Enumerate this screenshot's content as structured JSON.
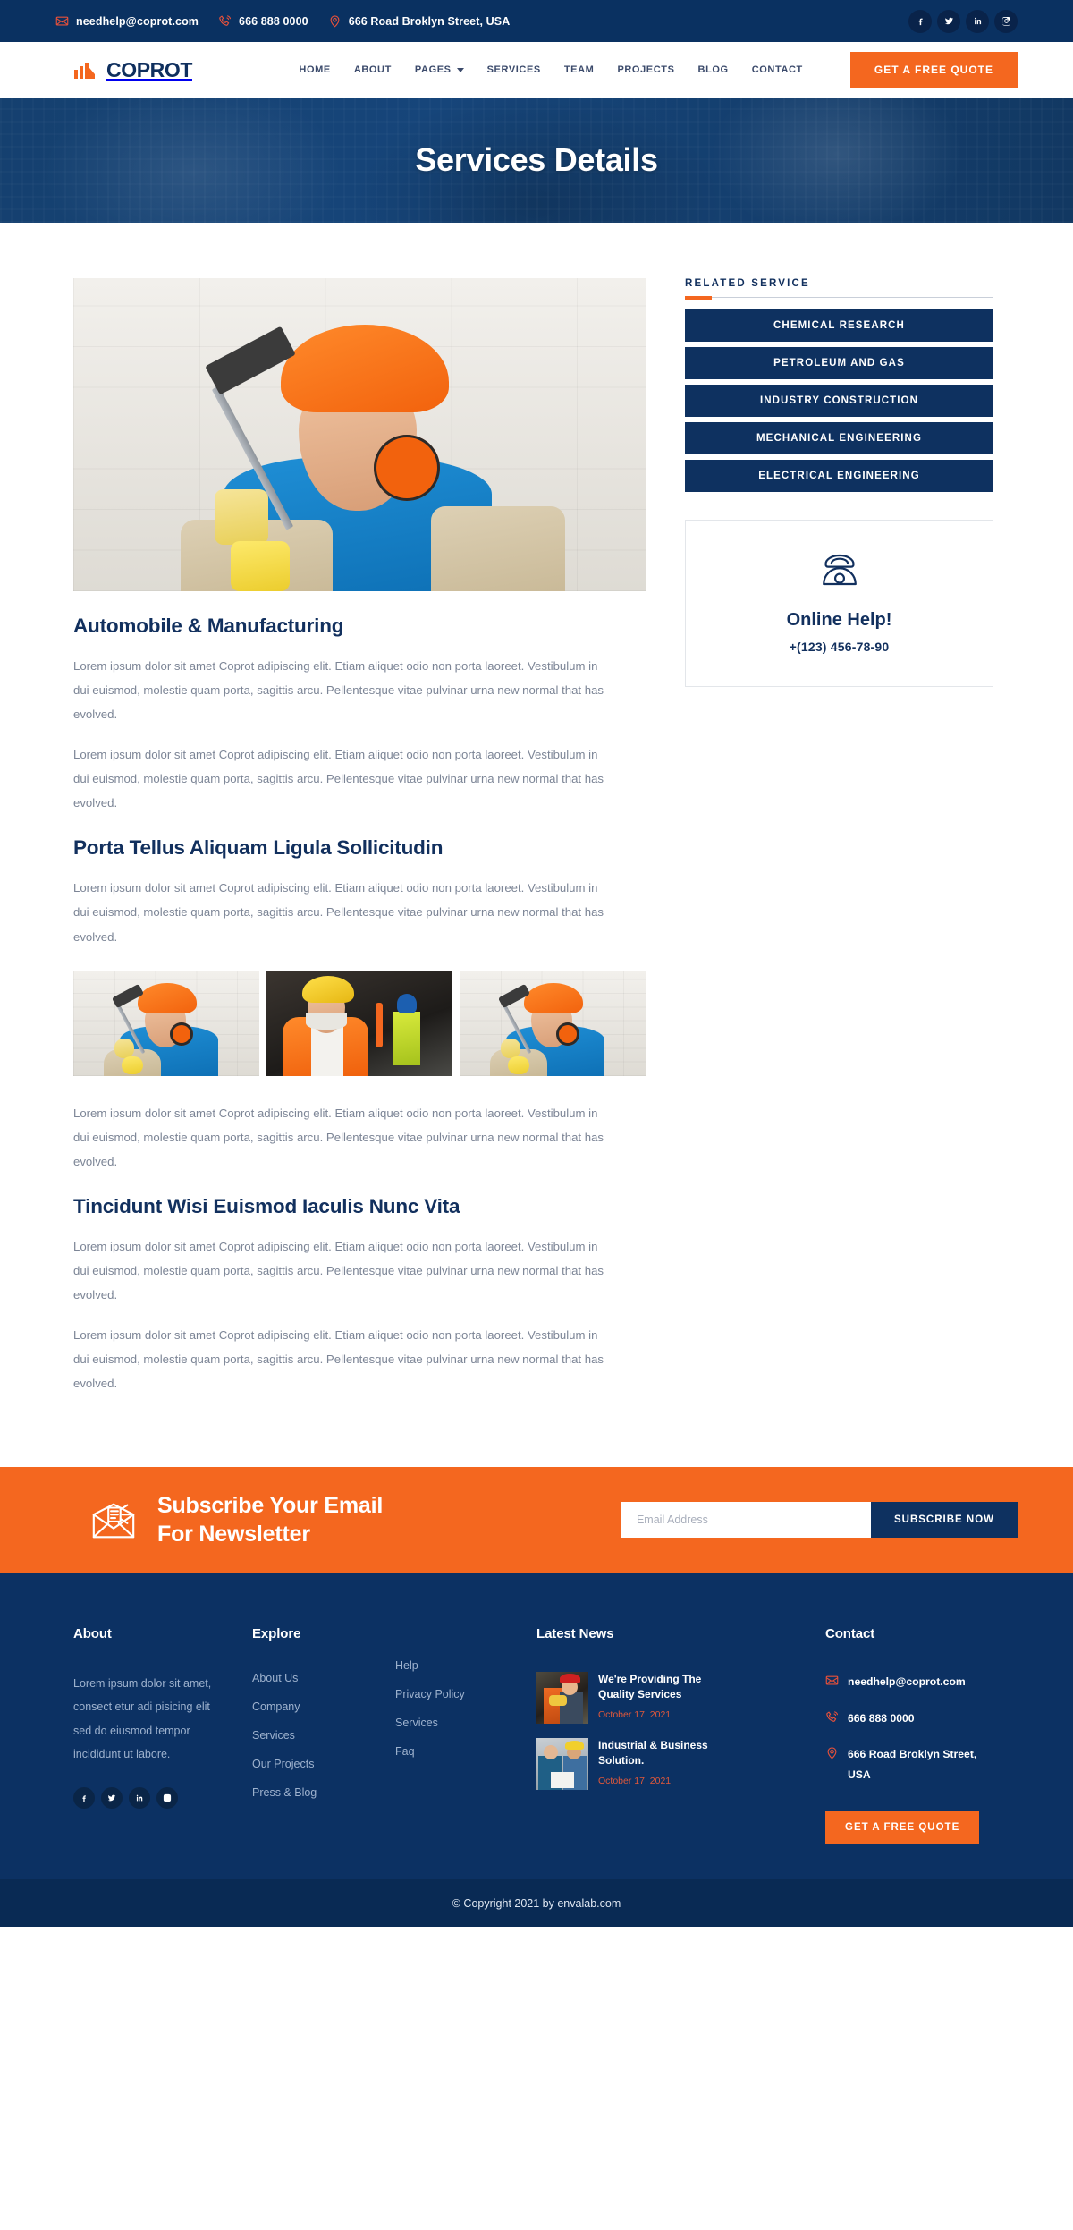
{
  "topbar": {
    "contacts": [
      {
        "icon": "email-icon",
        "text": "needhelp@coprot.com"
      },
      {
        "icon": "phone-icon",
        "text": "666 888 0000"
      },
      {
        "icon": "location-pin-icon",
        "text": "666 Road Broklyn Street, USA"
      }
    ],
    "socials": [
      "facebook-icon",
      "twitter-icon",
      "linkedin-icon",
      "instagram-icon"
    ]
  },
  "header": {
    "brand": "COPROT",
    "nav": [
      {
        "label": "HOME",
        "dropdown": false
      },
      {
        "label": "ABOUT",
        "dropdown": false
      },
      {
        "label": "PAGES",
        "dropdown": true
      },
      {
        "label": "SERVICES",
        "dropdown": false
      },
      {
        "label": "TEAM",
        "dropdown": false
      },
      {
        "label": "PROJECTS",
        "dropdown": false
      },
      {
        "label": "BLOG",
        "dropdown": false
      },
      {
        "label": "CONTACT",
        "dropdown": false
      }
    ],
    "quote_button": "GET A FREE QUOTE"
  },
  "hero": {
    "title": "Services Details"
  },
  "main": {
    "sections": [
      {
        "heading": "Automobile & Manufacturing",
        "paragraphs": [
          "Lorem ipsum dolor sit amet Coprot adipiscing elit. Etiam aliquet odio non porta laoreet. Vestibulum in dui euismod, molestie quam porta, sagittis arcu. Pellentesque vitae pulvinar urna new normal that has evolved.",
          "Lorem ipsum dolor sit amet Coprot adipiscing elit. Etiam aliquet odio non porta laoreet. Vestibulum in dui euismod, molestie quam porta, sagittis arcu. Pellentesque vitae pulvinar urna new normal that has evolved."
        ]
      },
      {
        "heading": "Porta Tellus Aliquam Ligula Sollicitudin",
        "paragraphs": [
          "Lorem ipsum dolor sit amet Coprot adipiscing elit. Etiam aliquet odio non porta laoreet. Vestibulum in dui euismod, molestie quam porta, sagittis arcu. Pellentesque vitae pulvinar urna new normal that has evolved."
        ],
        "paragraphs_after_gallery": [
          "Lorem ipsum dolor sit amet Coprot adipiscing elit. Etiam aliquet odio non porta laoreet. Vestibulum in dui euismod, molestie quam porta, sagittis arcu. Pellentesque vitae pulvinar urna new normal that has evolved."
        ]
      },
      {
        "heading": "Tincidunt Wisi Euismod Iaculis Nunc Vita",
        "paragraphs": [
          "Lorem ipsum dolor sit amet Coprot adipiscing elit. Etiam aliquet odio non porta laoreet. Vestibulum in dui euismod, molestie quam porta, sagittis arcu. Pellentesque vitae pulvinar urna new normal that has evolved.",
          "Lorem ipsum dolor sit amet Coprot adipiscing elit. Etiam aliquet odio non porta laoreet. Vestibulum in dui euismod, molestie quam porta, sagittis arcu. Pellentesque vitae pulvinar urna new normal that has evolved."
        ]
      }
    ]
  },
  "sidebar": {
    "related_title": "RELATED SERVICE",
    "services": [
      "CHEMICAL RESEARCH",
      "PETROLEUM AND GAS",
      "INDUSTRY CONSTRUCTION",
      "MECHANICAL ENGINEERING",
      "ELECTRICAL ENGINEERING"
    ],
    "help": {
      "icon": "telephone-icon",
      "title": "Online Help!",
      "phone": "+(123) 456-78-90"
    }
  },
  "newsletter": {
    "icon": "newsletter-envelope-icon",
    "heading_line1": "Subscribe Your Email",
    "heading_line2": "For Newsletter",
    "input_placeholder": "Email Address",
    "input_value": "",
    "button": "SUBSCRIBE NOW"
  },
  "footer": {
    "about": {
      "title": "About",
      "text": "Lorem ipsum dolor sit amet, consect etur adi pisicing elit sed do eiusmod tempor incididunt ut labore.",
      "socials": [
        "facebook-icon",
        "twitter-icon",
        "linkedin-icon",
        "instagram-icon"
      ]
    },
    "explore": {
      "title": "Explore",
      "links": [
        "About Us",
        "Company",
        "Services",
        "Our Projects",
        "Press & Blog"
      ]
    },
    "help_links": [
      "Help",
      "Privacy Policy",
      "Services",
      "Faq"
    ],
    "latest_news": {
      "title": "Latest News",
      "items": [
        {
          "title": "We're Providing The Quality Services",
          "date": "October 17, 2021"
        },
        {
          "title": "Industrial & Business Solution.",
          "date": "October 17, 2021"
        }
      ]
    },
    "contact": {
      "title": "Contact",
      "items": [
        {
          "icon": "email-icon",
          "text": "needhelp@coprot.com"
        },
        {
          "icon": "phone-icon",
          "text": "666 888 0000"
        },
        {
          "icon": "location-pin-icon",
          "text": "666 Road Broklyn Street, USA"
        }
      ],
      "quote_button": "GET A FREE QUOTE"
    },
    "copyright": "© Copyright 2021 by envalab.com"
  },
  "colors": {
    "navy": "#0a3161",
    "navy_deep": "#0c3163",
    "orange": "#f4671f",
    "accent_red": "#e8513a",
    "body_text": "#7c8596"
  }
}
